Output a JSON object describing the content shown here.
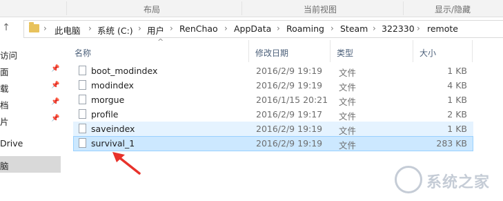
{
  "ribbon": {
    "tab_center": "布局",
    "tab_view": "当前视图",
    "tab_right": "显示/隐藏"
  },
  "address": {
    "crumbs": [
      "此电脑",
      "系统 (C:)",
      "用户",
      "RenChao",
      "AppData",
      "Roaming",
      "Steam",
      "322330",
      "remote"
    ],
    "separator": "›"
  },
  "nav": {
    "back": "←",
    "forward": "→",
    "up": "↑",
    "items": [
      {
        "label": "访问",
        "pinned": false
      },
      {
        "label": "面",
        "pinned": true
      },
      {
        "label": "载",
        "pinned": true
      },
      {
        "label": "档",
        "pinned": true
      },
      {
        "label": "片",
        "pinned": true
      },
      {
        "label": "Drive",
        "pinned": false
      },
      {
        "label": "脑",
        "pinned": false,
        "selected": true
      }
    ],
    "pin_glyph": "📌"
  },
  "columns": {
    "name": "名称",
    "date": "修改日期",
    "type": "类型",
    "size": "大小",
    "sort_glyph": "^"
  },
  "files": [
    {
      "name": "boot_modindex",
      "date": "2016/2/9 19:19",
      "type": "文件",
      "size": "1 KB",
      "state": "normal"
    },
    {
      "name": "modindex",
      "date": "2016/2/9 19:19",
      "type": "文件",
      "size": "4 KB",
      "state": "normal"
    },
    {
      "name": "morgue",
      "date": "2016/1/15 20:21",
      "type": "文件",
      "size": "1 KB",
      "state": "normal"
    },
    {
      "name": "profile",
      "date": "2016/2/9 19:17",
      "type": "文件",
      "size": "2 KB",
      "state": "normal"
    },
    {
      "name": "saveindex",
      "date": "2016/2/9 19:19",
      "type": "文件",
      "size": "1 KB",
      "state": "hover"
    },
    {
      "name": "survival_1",
      "date": "2016/2/9 19:19",
      "type": "文件",
      "size": "283 KB",
      "state": "selected"
    }
  ],
  "annotation": {
    "arrow_color": "#e8322b"
  },
  "watermark": {
    "text": "系统之家"
  }
}
